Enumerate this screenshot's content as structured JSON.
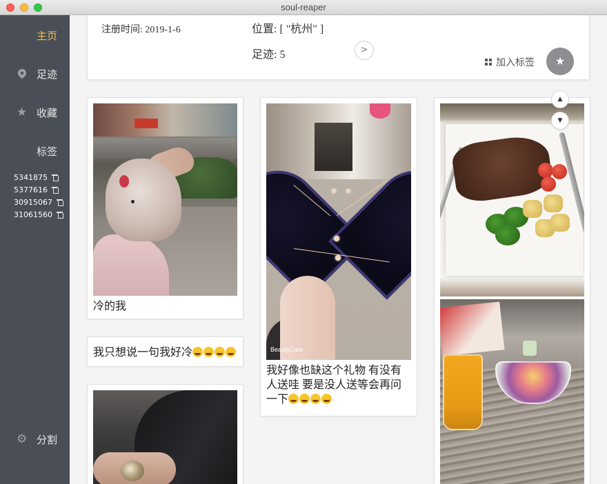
{
  "window": {
    "title": "soul-reaper"
  },
  "sidebar": {
    "items": [
      {
        "label": "主页",
        "icon": "grid-icon",
        "active": true
      },
      {
        "label": "足迹",
        "icon": "map-pin-icon"
      },
      {
        "label": "收藏",
        "icon": "star-icon"
      },
      {
        "label": "标签",
        "icon": "grid-icon"
      }
    ],
    "tags": [
      "5341875",
      "5377616",
      "30915067",
      "31061560"
    ],
    "bottom_item": {
      "label": "分割",
      "icon": "gear-icon"
    }
  },
  "profile": {
    "register_time": "注册时间: 2019-1-6",
    "location": "位置: [ \"杭州\" ]",
    "footprint": "足迹: 5",
    "add_tag_label": "加入标签",
    "next_icon": "chevron-right-icon",
    "favorite_icon": "star-icon"
  },
  "scroll": {
    "up_icon": "caret-up-icon",
    "down_icon": "caret-down-icon"
  },
  "posts": [
    {
      "caption": "冷的我"
    },
    {
      "caption": "我只想说一句我好冷",
      "emoji_count": 4
    },
    {
      "caption_lines": [
        "我好像也缺这个礼物 有没有",
        "人送哇 要是没人送等会再问",
        "一下"
      ],
      "emoji_count": 4
    },
    {
      "watermark": "BeautyCam"
    }
  ],
  "colors": {
    "accent": "#f2bc42",
    "sidebar_bg": "#4a4f57"
  }
}
